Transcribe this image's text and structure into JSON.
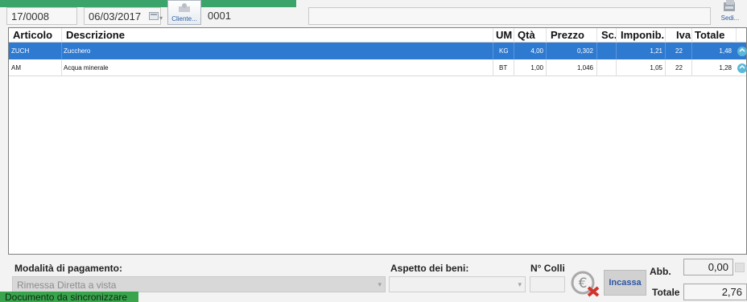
{
  "header": {
    "doc_number": "17/0008",
    "date": "06/03/2017",
    "client_button": "Cliente...",
    "client_code": "0001",
    "sedi_button": "Sedi..."
  },
  "grid": {
    "columns": [
      "Articolo",
      "Descrizione",
      "UM",
      "Qtà",
      "Prezzo",
      "Sc.",
      "Imponib.",
      "Iva",
      "Totale"
    ],
    "rows": [
      {
        "articolo": "ZUCH",
        "descrizione": "Zucchero",
        "um": "KG",
        "qta": "4,00",
        "prezzo": "0,302",
        "sc": "",
        "imponib": "1,21",
        "iva": "22",
        "totale": "1,48",
        "selected": true
      },
      {
        "articolo": "AM",
        "descrizione": "Acqua minerale",
        "um": "BT",
        "qta": "1,00",
        "prezzo": "1,046",
        "sc": "",
        "imponib": "1,05",
        "iva": "22",
        "totale": "1,28",
        "selected": false
      }
    ]
  },
  "footer": {
    "payment_label": "Modalità di pagamento:",
    "payment_value": "Rimessa Diretta a vista",
    "aspect_label": "Aspetto dei beni:",
    "aspect_value": "",
    "colli_label": "N° Colli",
    "colli_value": "",
    "incassa_label": "Incassa",
    "abb_label": "Abb.",
    "abb_value": "0,00",
    "totale_label": "Totale",
    "totale_value": "2,76"
  },
  "status": {
    "text": "Documento da sincronizzare"
  },
  "colors": {
    "selection": "#2f7ad1",
    "status_green": "#3aa44d",
    "header_green": "#3aa46b",
    "incassa_text": "#2a56a6"
  },
  "icons": [
    "calendar-icon",
    "client-icon",
    "sedi-icon",
    "row-edit-icon",
    "euro-cancel-icon",
    "abb-action-icon",
    "dropdown-chevron-icon"
  ]
}
